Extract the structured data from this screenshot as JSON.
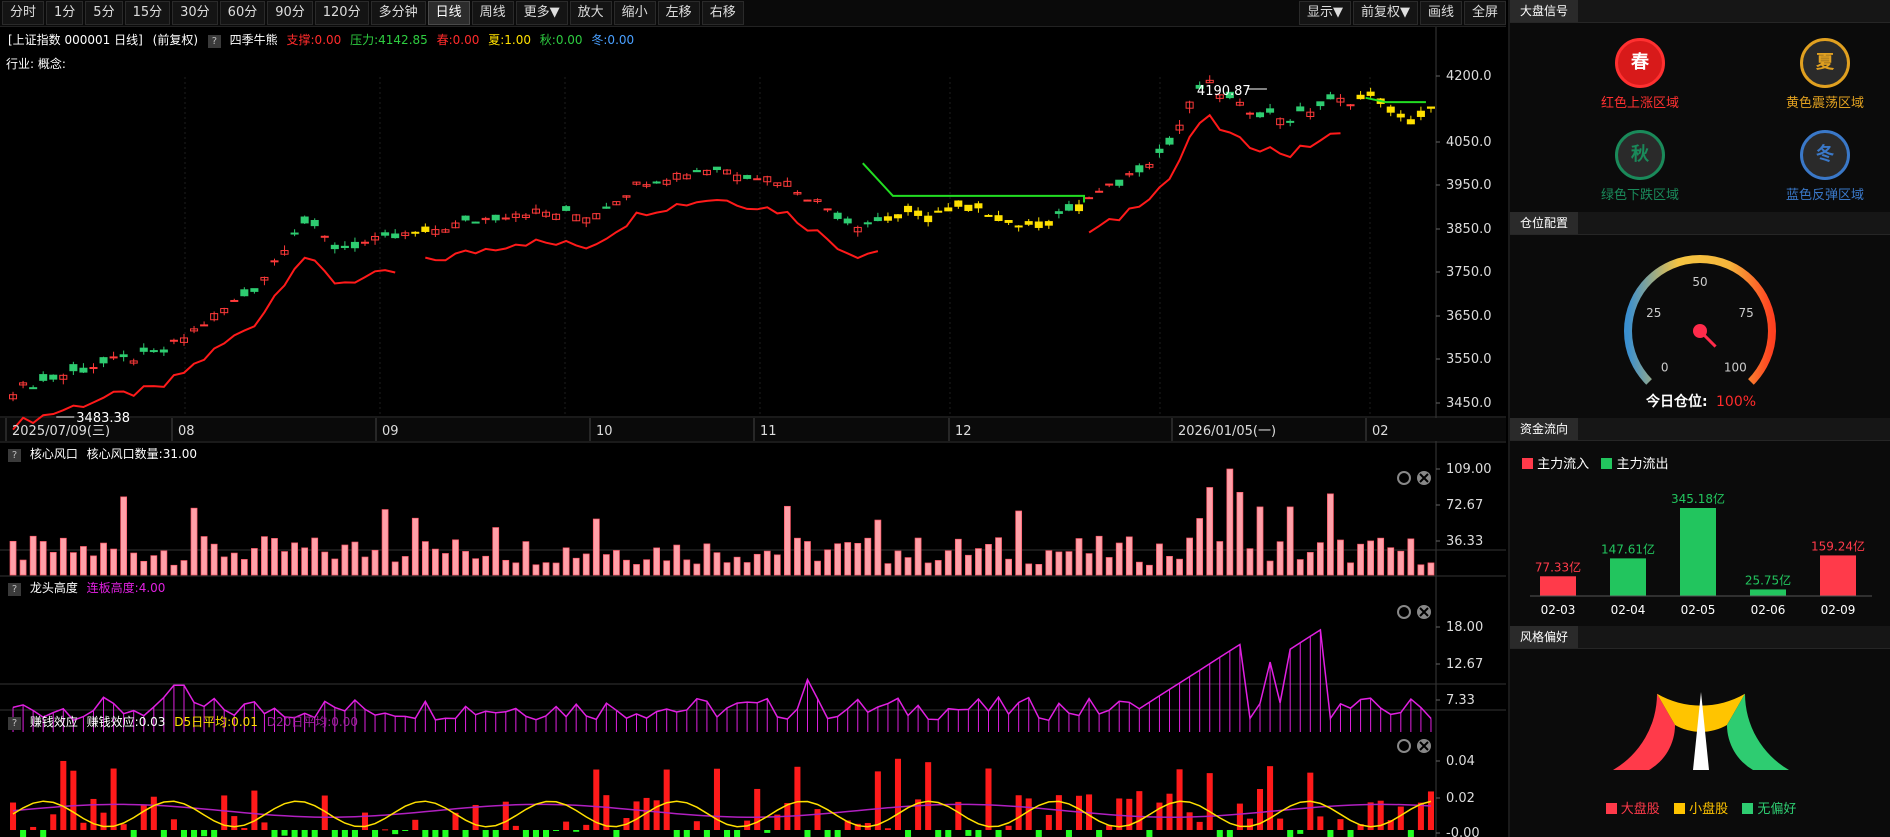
{
  "toolbar": {
    "periods": [
      "分时",
      "1分",
      "5分",
      "15分",
      "30分",
      "60分",
      "90分",
      "120分",
      "多分钟",
      "日线",
      "周线",
      "更多▼",
      "放大",
      "缩小",
      "左移",
      "右移"
    ],
    "active": "日线",
    "right": [
      "显示▼",
      "前复权▼",
      "画线",
      "全屏"
    ]
  },
  "main_chart": {
    "header": {
      "title": "[上证指数 000001 日线]",
      "adjust": "(前复权)",
      "qmark": "?",
      "indicator": "四季牛熊",
      "support": "支撑:0.00",
      "pressure": "压力:4142.85",
      "spring": "春:0.00",
      "summer": "夏:1.00",
      "autumn": "秋:0.00",
      "winter": "冬:0.00"
    },
    "industry": "行业: 概念:",
    "high_label": "4190.87",
    "low_label": "3483.38",
    "y_ticks": [
      "4200.0",
      "4050.0",
      "3950.0",
      "3850.0",
      "3750.0",
      "3650.0",
      "3550.0",
      "3450.0"
    ],
    "x_labels": [
      "2025/07/09(三)",
      "08",
      "09",
      "10",
      "11",
      "12",
      "2026/01/05(一)",
      "02"
    ]
  },
  "panes": [
    {
      "qmark": "?",
      "name": "核心风口",
      "detail": "核心风口数量:31.00",
      "y_ticks": [
        "109.00",
        "72.67",
        "36.33"
      ]
    },
    {
      "qmark": "?",
      "name": "龙头高度",
      "detail": "连板高度:4.00",
      "y_ticks": [
        "18.00",
        "12.67",
        "7.33"
      ]
    },
    {
      "qmark": "?",
      "name": "赚钱效应",
      "detail": "赚钱效应:0.03",
      "d5": "D5日平均:0.01",
      "d20": "D20日平均:0.00",
      "y_ticks": [
        "0.04",
        "0.02",
        "-0.00"
      ]
    }
  ],
  "right_panel": {
    "signal_tab": "大盘信号",
    "seasons": [
      {
        "char": "春",
        "label": "红色上涨区域",
        "color": "#ff3030"
      },
      {
        "char": "夏",
        "label": "黄色震荡区域",
        "color": "#e0a020"
      },
      {
        "char": "秋",
        "label": "绿色下跌区域",
        "color": "#1a8a5a"
      },
      {
        "char": "冬",
        "label": "蓝色反弹区域",
        "color": "#3a78c8"
      }
    ],
    "position_tab": "仓位配置",
    "gauge": {
      "labels": [
        "0",
        "25",
        "50",
        "75",
        "100"
      ],
      "caption": "今日仓位:",
      "value": "100%",
      "value_fraction": 1.0
    },
    "flow_tab": "资金流向",
    "flow_legend": {
      "inflow": "主力流入",
      "outflow": "主力流出"
    },
    "flow_bars": [
      {
        "date": "02-03",
        "value": 77.33,
        "label": "77.33亿",
        "dir": "in"
      },
      {
        "date": "02-04",
        "value": 147.61,
        "label": "147.61亿",
        "dir": "out"
      },
      {
        "date": "02-05",
        "value": 345.18,
        "label": "345.18亿",
        "dir": "out"
      },
      {
        "date": "02-06",
        "value": 25.75,
        "label": "25.75亿",
        "dir": "out"
      },
      {
        "date": "02-09",
        "value": 159.24,
        "label": "159.24亿",
        "dir": "in"
      }
    ],
    "style_tab": "风格偏好",
    "style_legend": [
      "大盘股",
      "小盘股",
      "无偏好"
    ],
    "style_needle": "小盘股"
  },
  "colors": {
    "up": "#ff3a3a",
    "down": "#2ecc71",
    "yellow": "#ffe000",
    "accent_red": "#ff2b2b",
    "magenta": "#e020e0",
    "pink": "#ffa0a8"
  }
}
